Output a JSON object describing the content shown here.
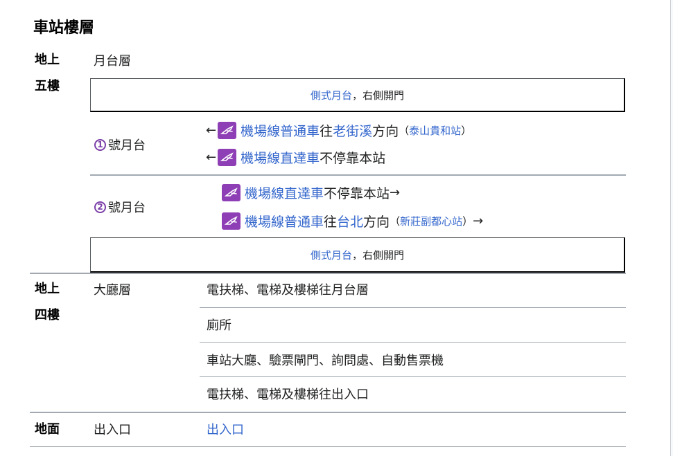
{
  "title": "車站樓層",
  "floors": {
    "b5": {
      "label": [
        "地上",
        "五樓"
      ],
      "zone": "月台層",
      "side_platform": {
        "name": "側式月台",
        "sep": "，",
        "door": "右側開門"
      },
      "platforms": [
        {
          "number": "1",
          "label": "號月台",
          "lines": [
            {
              "arrow_before": "←",
              "name": "機場線普通車",
              "text_a": " 往",
              "dest": "老街溪",
              "text_b": "方向",
              "paren_open": "（",
              "terminal": "泰山貴和站",
              "paren_close": "）",
              "arrow_after": ""
            },
            {
              "arrow_before": "←",
              "name": "機場線直達車",
              "text_a": " 不停靠本站",
              "dest": "",
              "text_b": "",
              "paren_open": "",
              "terminal": "",
              "paren_close": "",
              "arrow_after": ""
            }
          ]
        },
        {
          "number": "2",
          "label": "號月台",
          "lines": [
            {
              "arrow_before": "",
              "name": "機場線直達車",
              "text_a": " 不停靠本站",
              "dest": "",
              "text_b": "",
              "paren_open": "",
              "terminal": "",
              "paren_close": "",
              "arrow_after": "→"
            },
            {
              "arrow_before": "",
              "name": "機場線普通車",
              "text_a": " 往",
              "dest": "台北",
              "text_b": "方向",
              "paren_open": "（",
              "terminal": "新莊副都心站",
              "paren_close": "）",
              "arrow_after": " →"
            }
          ]
        }
      ]
    },
    "b4": {
      "label": [
        "地上",
        "四樓"
      ],
      "zone": "大廳層",
      "facilities": [
        "電扶梯、電梯及樓梯往月台層",
        "廁所",
        "車站大廳、驗票閘門、詢問處、自動售票機",
        "電扶梯、電梯及樓梯往出入口"
      ]
    },
    "ground": {
      "label": "地面",
      "zone": "出入口",
      "facility": "出入口"
    }
  },
  "colors": {
    "link": "#3366cc",
    "line_icon": "#8e3fb5",
    "border": "#a2a9b1"
  },
  "icons": {
    "line": "airport-line-plane-icon"
  }
}
